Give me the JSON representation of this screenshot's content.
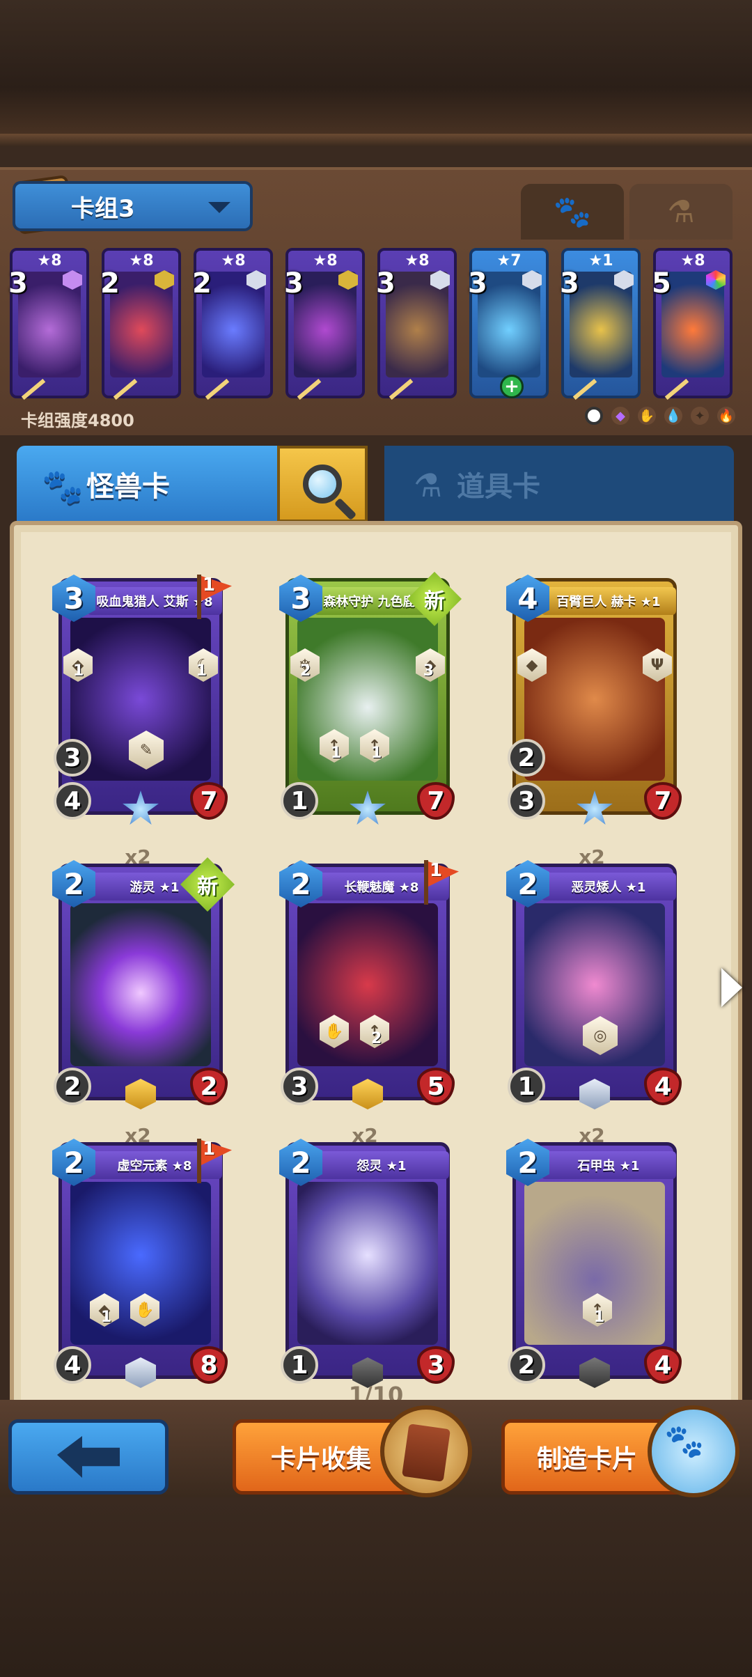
{
  "deck": {
    "name": "卡组3",
    "strength": "卡组强度4800",
    "tab_monster_icon": "paw-icon",
    "tab_item_icon": "flask-icon",
    "cards": [
      {
        "stars": "★8",
        "cost": "3",
        "color": "purple"
      },
      {
        "stars": "★8",
        "cost": "2",
        "color": "purple"
      },
      {
        "stars": "★8",
        "cost": "2",
        "color": "purple"
      },
      {
        "stars": "★8",
        "cost": "3",
        "color": "purple"
      },
      {
        "stars": "★8",
        "cost": "3",
        "color": "purple"
      },
      {
        "stars": "★7",
        "cost": "3",
        "color": "blue"
      },
      {
        "stars": "★1",
        "cost": "3",
        "color": "blue"
      },
      {
        "stars": "★8",
        "cost": "5",
        "color": "purple"
      }
    ]
  },
  "categories": {
    "monster": "怪兽卡",
    "item": "道具卡"
  },
  "cards": [
    {
      "name": "吸血鬼猎人 艾斯 ★8",
      "cost": "3",
      "spd": "3",
      "atk": "4",
      "hp": "7",
      "flag": "1",
      "frame": "purple",
      "abilities": [
        "1",
        "1"
      ]
    },
    {
      "name": "森林守护 九色鹿 ★1",
      "cost": "3",
      "spd": "",
      "atk": "1",
      "hp": "7",
      "new": "新",
      "frame": "green",
      "abilities": [
        "2",
        "3",
        "1",
        "1"
      ]
    },
    {
      "name": "百臂巨人 赫卡 ★1",
      "cost": "4",
      "spd": "2",
      "atk": "3",
      "hp": "7",
      "frame": "gold",
      "abilities": []
    },
    {
      "name": "游灵 ★1",
      "cost": "2",
      "spd": "2",
      "atk": "",
      "hp": "2",
      "new": "新",
      "dup": "x2",
      "frame": "purple",
      "abilities": []
    },
    {
      "name": "长鞭魅魔 ★8",
      "cost": "2",
      "spd": "",
      "atk": "3",
      "hp": "5",
      "flag": "1",
      "frame": "purple",
      "abilities": [
        "2"
      ]
    },
    {
      "name": "恶灵矮人 ★1",
      "cost": "2",
      "spd": "1",
      "atk": "",
      "hp": "4",
      "dup": "x2",
      "frame": "purple",
      "abilities": []
    },
    {
      "name": "虚空元素 ★8",
      "cost": "2",
      "spd": "",
      "atk": "4",
      "hp": "8",
      "flag": "1",
      "dup": "x2",
      "frame": "purple",
      "abilities": [
        "1"
      ]
    },
    {
      "name": "怨灵 ★1",
      "cost": "2",
      "spd": "1",
      "atk": "",
      "hp": "3",
      "dup": "x2",
      "frame": "purple",
      "abilities": []
    },
    {
      "name": "石甲虫 ★1",
      "cost": "2",
      "spd": "",
      "atk": "2",
      "hp": "4",
      "dup": "x2",
      "frame": "purple",
      "abilities": [
        "1"
      ]
    }
  ],
  "pager": "1/10",
  "buttons": {
    "collect": "卡片收集",
    "craft": "制造卡片"
  }
}
